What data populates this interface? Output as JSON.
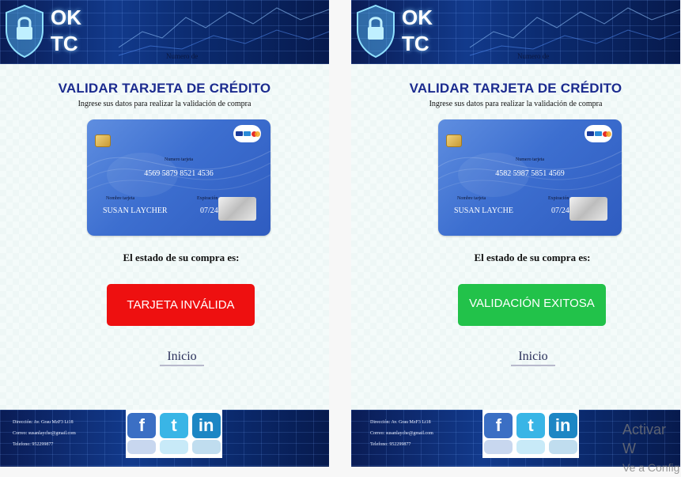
{
  "header": {
    "logo_line1": "OK",
    "logo_line2": "TC",
    "banner_caption": "Numero de"
  },
  "page": {
    "title": "VALIDAR TARJETA DE CRÉDITO",
    "subtitle": "Ingrese sus datos para realizar la validación de compra"
  },
  "panels": [
    {
      "card": {
        "number_label": "Numero tarjeta",
        "number": "4569 5879 8521 4536",
        "name_label": "Nombre tarjeta",
        "name": "SUSAN LAYCHER",
        "exp_label": "Expiración",
        "exp": "07/24"
      },
      "status_label": "El estado de su compra es:",
      "result": "TARJETA INVÁLIDA",
      "result_color": "#ee1010"
    },
    {
      "card": {
        "number_label": "Numero tarjeta",
        "number": "4582 5987 5851 4569",
        "name_label": "Nombre tarjeta",
        "name": "SUSAN LAYCHE",
        "exp_label": "Expiración",
        "exp": "07/24"
      },
      "status_label": "El estado de su compra es:",
      "result": "VALIDACIÓN EXITOSA",
      "result_color": "#22c24a"
    }
  ],
  "nav": {
    "home_link": "Inicio"
  },
  "footer": {
    "address": "Dirección: Av. Grau MzF3 Lt18",
    "email": "Correo: susanlayche@gmail.com",
    "phone": "Telefono: 952299877",
    "social": [
      "facebook",
      "twitter",
      "linkedin"
    ]
  },
  "os_watermark": {
    "line1": "Activar W",
    "line2": "Ve a Config"
  },
  "icons": [
    "shield-lock-icon",
    "chip-icon",
    "card-brands-icon",
    "hologram-icon",
    "facebook-icon",
    "twitter-icon",
    "linkedin-icon"
  ]
}
